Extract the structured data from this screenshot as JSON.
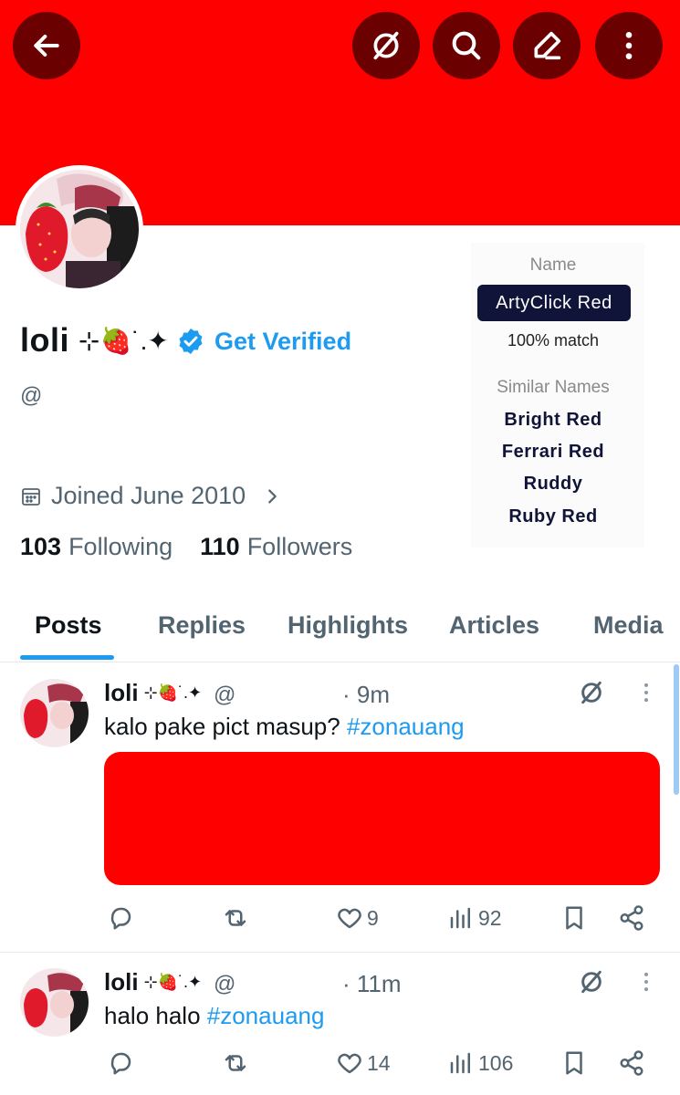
{
  "colors": {
    "banner": "#ff0000",
    "accent": "#1d9bf0",
    "header_button": "#6b0000"
  },
  "header": {
    "icons": [
      "back-arrow-icon",
      "grok-icon",
      "search-icon",
      "edit-pencil-icon",
      "more-vertical-icon"
    ]
  },
  "profile": {
    "display_name": "loli",
    "name_decoration": "⊹🍓˙.✦",
    "verified_text": "Get Verified",
    "handle": "@",
    "joined": "Joined June 2010",
    "following_count": "103",
    "following_label": "Following",
    "followers_count": "110",
    "followers_label": "Followers"
  },
  "color_panel": {
    "name_label": "Name",
    "color_name": "ArtyClick Red",
    "match": "100% match",
    "similar_label": "Similar Names",
    "similar": [
      "Bright Red",
      "Ferrari Red",
      "Ruddy",
      "Ruby Red"
    ]
  },
  "tabs": [
    {
      "label": "Posts",
      "active": true
    },
    {
      "label": "Replies",
      "active": false
    },
    {
      "label": "Highlights",
      "active": false
    },
    {
      "label": "Articles",
      "active": false
    },
    {
      "label": "Media",
      "active": false
    }
  ],
  "posts": [
    {
      "name": "loli",
      "decoration": "⊹🍓˙.✦",
      "handle": "@",
      "time": "· 9m",
      "text": "kalo pake pict masup? ",
      "hashtag": "#zonauang",
      "has_media": true,
      "likes": "9",
      "views": "92"
    },
    {
      "name": "loli",
      "decoration": "⊹🍓˙.✦",
      "handle": "@",
      "time": "· 11m",
      "text": "halo halo ",
      "hashtag": "#zonauang",
      "has_media": false,
      "likes": "14",
      "views": "106"
    }
  ]
}
